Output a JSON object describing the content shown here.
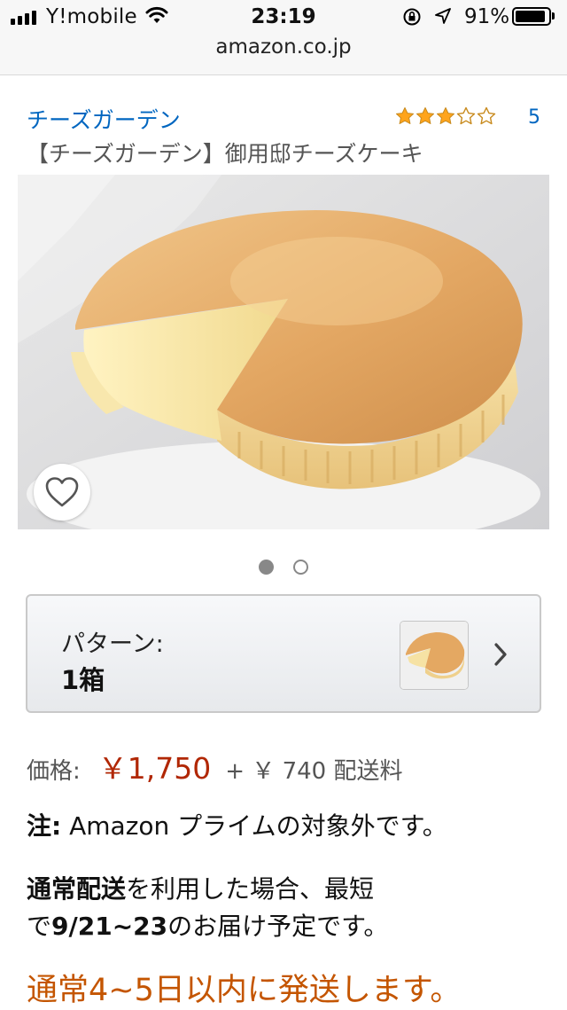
{
  "status_bar": {
    "carrier": "Y!mobile",
    "time": "23:19",
    "battery_pct_label": "91%",
    "battery_level": 0.91
  },
  "browser": {
    "url": "amazon.co.jp"
  },
  "product": {
    "brand": "チーズガーデン",
    "title": "【チーズガーデン】御用邸チーズケーキ",
    "rating": 3,
    "rating_max": 5,
    "review_count": "5",
    "image_count": 2,
    "current_image_index": 0
  },
  "pattern": {
    "label": "パターン:",
    "value": "1箱"
  },
  "price": {
    "label": "価格:",
    "amount": "￥1,750",
    "shipping": "+ ￥ 740 配送料"
  },
  "note": {
    "bold": "注:",
    "text": " Amazon プライムの対象外です。"
  },
  "delivery": {
    "bold1": "通常配送",
    "text1": "を利用した場合、最短",
    "text2": "で",
    "bold2": "9/21~23",
    "text3": "のお届け予定です。"
  },
  "shipping_notice": "通常4~5日以内に発送します。",
  "colors": {
    "link": "#0066c0",
    "price": "#b12704",
    "ship": "#c45500",
    "star": "#ffa41c"
  },
  "icons": [
    "wifi-icon",
    "rotation-lock-icon",
    "location-arrow-icon",
    "battery-icon",
    "star-icon",
    "heart-icon",
    "chevron-right-icon"
  ]
}
